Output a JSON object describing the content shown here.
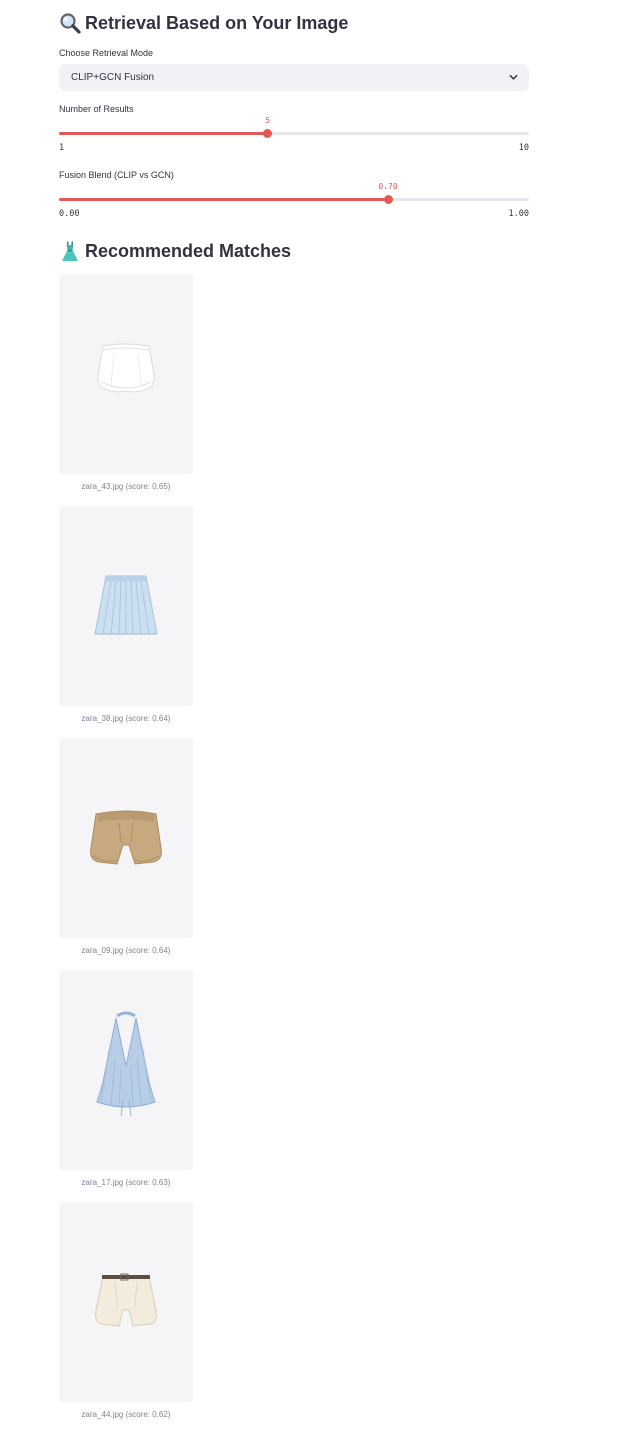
{
  "retrieval": {
    "title": "Retrieval Based on Your Image",
    "title_icon": "magnifying-glass-icon"
  },
  "mode": {
    "label": "Choose Retrieval Mode",
    "value": "CLIP+GCN Fusion"
  },
  "results_slider": {
    "label": "Number of Results",
    "value": "5",
    "min": "1",
    "max": "10",
    "fraction": 0.444
  },
  "fusion_slider": {
    "label": "Fusion Blend (CLIP vs GCN)",
    "value": "0.70",
    "min": "0.00",
    "max": "1.00",
    "fraction": 0.7
  },
  "matches": {
    "title": "Recommended Matches",
    "title_icon": "dress-icon",
    "items": [
      {
        "caption": "zara_43.jpg (score: 0.65)",
        "garment": "white-balloon-skirt"
      },
      {
        "caption": "zara_38.jpg (score: 0.64)",
        "garment": "light-blue-pleated-skirt"
      },
      {
        "caption": "zara_09.jpg (score: 0.64)",
        "garment": "khaki-paperbag-shorts"
      },
      {
        "caption": "zara_17.jpg (score: 0.63)",
        "garment": "blue-striped-halter-top"
      },
      {
        "caption": "zara_44.jpg (score: 0.62)",
        "garment": "cream-belted-shorts"
      }
    ]
  },
  "colors": {
    "accent": "#e05a58",
    "text": "#31333f",
    "caption": "#808495",
    "select_bg": "#f0f2f6",
    "card_bg": "#f5f5f7"
  }
}
